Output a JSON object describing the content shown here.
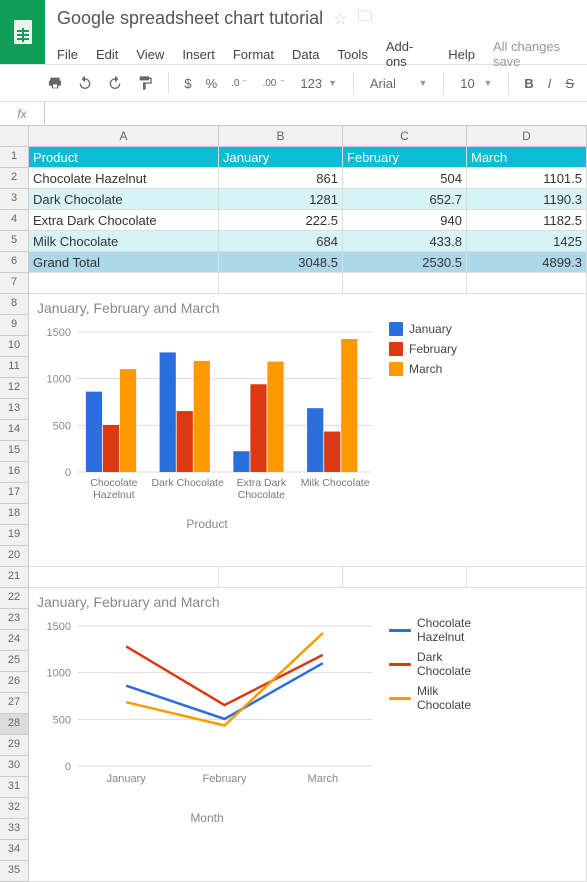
{
  "doc": {
    "title": "Google spreadsheet chart tutorial",
    "save_status": "All changes save"
  },
  "menu": {
    "file": "File",
    "edit": "Edit",
    "view": "View",
    "insert": "Insert",
    "format": "Format",
    "data": "Data",
    "tools": "Tools",
    "addons": "Add-ons",
    "help": "Help"
  },
  "toolbar": {
    "dollar": "$",
    "percent": "%",
    "dec_dec": ".0",
    "inc_dec": ".00",
    "more_fmt": "123",
    "font": "Arial",
    "font_size": "10",
    "bold": "B",
    "italic": "I",
    "strike": "S"
  },
  "fx": {
    "label": "fx"
  },
  "columns": {
    "A": "A",
    "B": "B",
    "C": "C",
    "D": "D"
  },
  "rows": [
    "1",
    "2",
    "3",
    "4",
    "5",
    "6",
    "7",
    "8",
    "9",
    "10",
    "11",
    "12",
    "13",
    "14",
    "15",
    "16",
    "17",
    "18",
    "19",
    "20",
    "21",
    "22",
    "23",
    "24",
    "25",
    "26",
    "27",
    "28",
    "29",
    "30",
    "31",
    "32",
    "33",
    "34",
    "35"
  ],
  "table": {
    "headers": {
      "product": "Product",
      "jan": "January",
      "feb": "February",
      "mar": "March"
    },
    "data": [
      {
        "product": "Chocolate Hazelnut",
        "jan": "861",
        "feb": "504",
        "mar": "1101.5"
      },
      {
        "product": "Dark Chocolate",
        "jan": "1281",
        "feb": "652.7",
        "mar": "1190.3"
      },
      {
        "product": "Extra Dark Chocolate",
        "jan": "222.5",
        "feb": "940",
        "mar": "1182.5"
      },
      {
        "product": "Milk Chocolate",
        "jan": "684",
        "feb": "433.8",
        "mar": "1425"
      }
    ],
    "total": {
      "product": "Grand Total",
      "jan": "3048.5",
      "feb": "2530.5",
      "mar": "4899.3"
    }
  },
  "chart_data": [
    {
      "type": "bar",
      "title": "January, February and March",
      "xlabel": "Product",
      "categories": [
        "Chocolate Hazelnut",
        "Dark Chocolate",
        "Extra Dark Chocolate",
        "Milk Chocolate"
      ],
      "series": [
        {
          "name": "January",
          "color": "#2a6fdb",
          "values": [
            861,
            1281,
            222.5,
            684
          ]
        },
        {
          "name": "February",
          "color": "#dc3912",
          "values": [
            504,
            652.7,
            940,
            433.8
          ]
        },
        {
          "name": "March",
          "color": "#ff9900",
          "values": [
            1101.5,
            1190.3,
            1182.5,
            1425
          ]
        }
      ],
      "ylim": [
        0,
        1500
      ],
      "yticks": [
        0,
        500,
        1000,
        1500
      ]
    },
    {
      "type": "line",
      "title": "January, February and March",
      "xlabel": "Month",
      "x": [
        "January",
        "February",
        "March"
      ],
      "series": [
        {
          "name": "Chocolate Hazelnut",
          "color": "#2a6fdb",
          "values": [
            861,
            504,
            1101.5
          ]
        },
        {
          "name": "Dark Chocolate",
          "color": "#dc3912",
          "values": [
            1281,
            652.7,
            1190.3
          ]
        },
        {
          "name": "Milk Chocolate",
          "color": "#ff9900",
          "values": [
            684,
            433.8,
            1425
          ]
        }
      ],
      "ylim": [
        0,
        1500
      ],
      "yticks": [
        0,
        500,
        1000,
        1500
      ]
    }
  ],
  "selected_row": 28
}
